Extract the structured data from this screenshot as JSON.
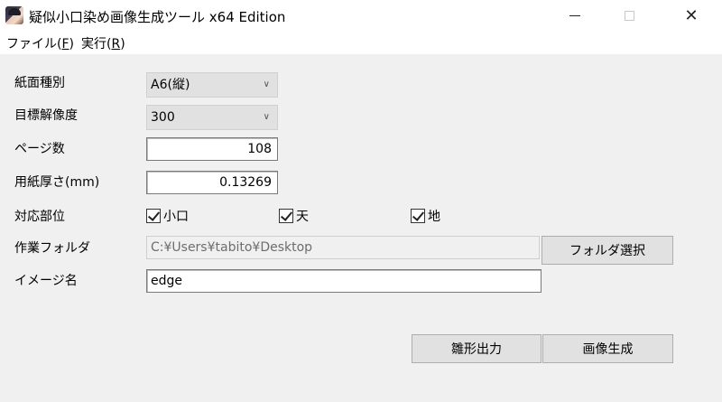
{
  "window": {
    "title": "疑似小口染め画像生成ツール x64 Edition",
    "minimize_glyph": "—",
    "close_glyph": "✕"
  },
  "menu": {
    "file_label": "ファイル(",
    "file_mnemonic": "F",
    "file_suffix": ")",
    "run_label": "実行(",
    "run_mnemonic": "R",
    "run_suffix": ")"
  },
  "form": {
    "paper_type": {
      "label": "紙面種別",
      "value": "A6(縦)"
    },
    "resolution": {
      "label": "目標解像度",
      "value": "300"
    },
    "pages": {
      "label": "ページ数",
      "value": "108"
    },
    "thickness": {
      "label": "用紙厚さ(mm)",
      "value": "0.13269"
    },
    "target": {
      "label": "対応部位",
      "options": [
        {
          "label": "小口",
          "checked": true
        },
        {
          "label": "天",
          "checked": true
        },
        {
          "label": "地",
          "checked": true
        }
      ]
    },
    "work_folder": {
      "label": "作業フォルダ",
      "value": "C:¥Users¥tabito¥Desktop",
      "button": "フォルダ選択"
    },
    "image_name": {
      "label": "イメージ名",
      "value": "edge"
    }
  },
  "actions": {
    "mold_output": "雛形出力",
    "generate": "画像生成"
  },
  "icons": {
    "dropdown": "chevron-down-icon",
    "check": "check-icon"
  }
}
